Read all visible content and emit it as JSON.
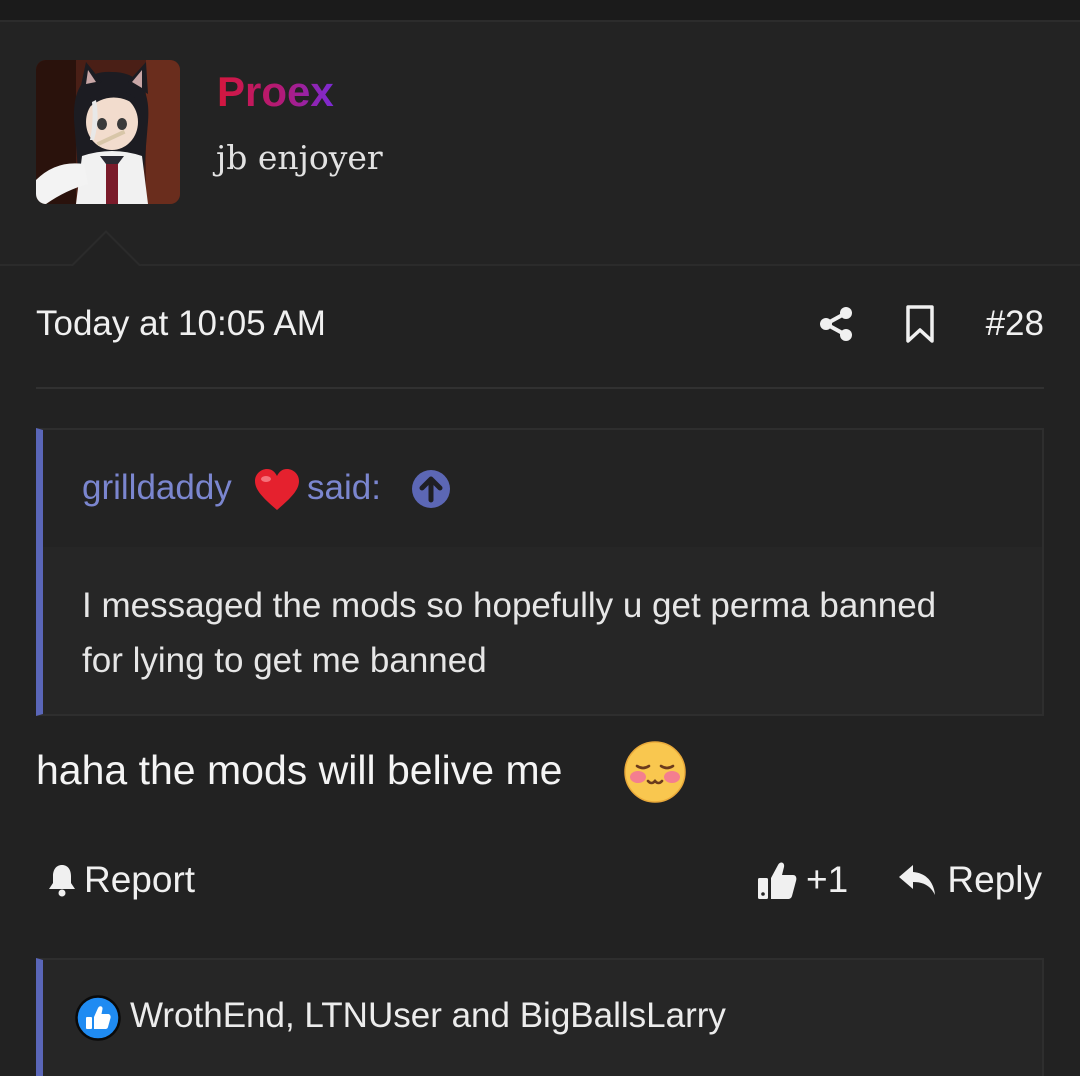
{
  "user": {
    "name": "Proex",
    "title": "jb enjoyer",
    "name_gradient": [
      "#d4173d",
      "#b21a78",
      "#7b2bd6"
    ]
  },
  "post": {
    "timestamp": "Today at 10:05 AM",
    "number": "#28",
    "icons": [
      "share-icon",
      "bookmark-icon"
    ]
  },
  "quote": {
    "author": "grilldaddy",
    "author_badge_icon": "heart-icon",
    "said_label": "said:",
    "goto_icon": "arrow-up-circle-icon",
    "text": "I messaged the mods so hopefully u get perma banned for lying to get me banned"
  },
  "message": {
    "text": "haha the mods will belive me",
    "emoji_icon": "blushing-emoji-icon"
  },
  "actions": {
    "report_label": "Report",
    "like_count": "+1",
    "reply_label": "Reply"
  },
  "reactions": {
    "icon": "like-reaction-icon",
    "users": "WrothEnd, LTNUser and BigBallsLarry"
  },
  "colors": {
    "background": "#222222",
    "accent": "#5a66b8",
    "quote_link": "#7b86cf"
  }
}
